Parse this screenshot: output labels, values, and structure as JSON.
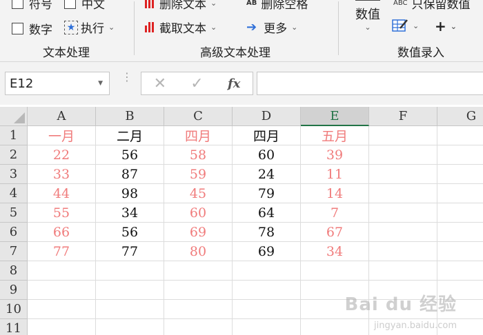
{
  "ribbon": {
    "items": {
      "fuhao": "符号",
      "zhongwen": "中文",
      "shuzi": "数字",
      "zhixing": "执行",
      "delete_text": "删除文本",
      "extract_text": "截取文本",
      "delete_spaces": "删除空格",
      "more": "更多",
      "abc_label": "ABC",
      "numeric": "数值",
      "keep_only_numbers": "只保留数值"
    },
    "groups": {
      "text_processing": "文本处理",
      "advanced_text": "高级文本处理",
      "number_entry": "数值录入"
    }
  },
  "formula_bar": {
    "name_box": "E12",
    "cancel_icon": "✕",
    "enter_icon": "✓",
    "fx_label": "fx",
    "formula": ""
  },
  "sheet": {
    "columns": [
      "A",
      "B",
      "C",
      "D",
      "E",
      "F",
      "G"
    ],
    "selected_column": "E",
    "rows": [
      [
        "一月",
        "二月",
        "四月",
        "四月",
        "五月"
      ],
      [
        "22",
        "56",
        "58",
        "60",
        "39"
      ],
      [
        "33",
        "87",
        "59",
        "24",
        "11"
      ],
      [
        "44",
        "98",
        "45",
        "79",
        "14"
      ],
      [
        "55",
        "34",
        "60",
        "64",
        "7"
      ],
      [
        "66",
        "56",
        "69",
        "78",
        "67"
      ],
      [
        "77",
        "77",
        "80",
        "69",
        "34"
      ]
    ],
    "row_numbers": [
      "1",
      "2",
      "3",
      "4",
      "5",
      "6",
      "7",
      "8",
      "9",
      "10",
      "11"
    ],
    "pink_columns": [
      0,
      2,
      4
    ],
    "colors": {
      "pink_text": "#f07b7b",
      "selected_header": "#217346"
    }
  },
  "watermark": {
    "main": "Bai du 经验",
    "sub": "jingyan.baidu.com"
  }
}
